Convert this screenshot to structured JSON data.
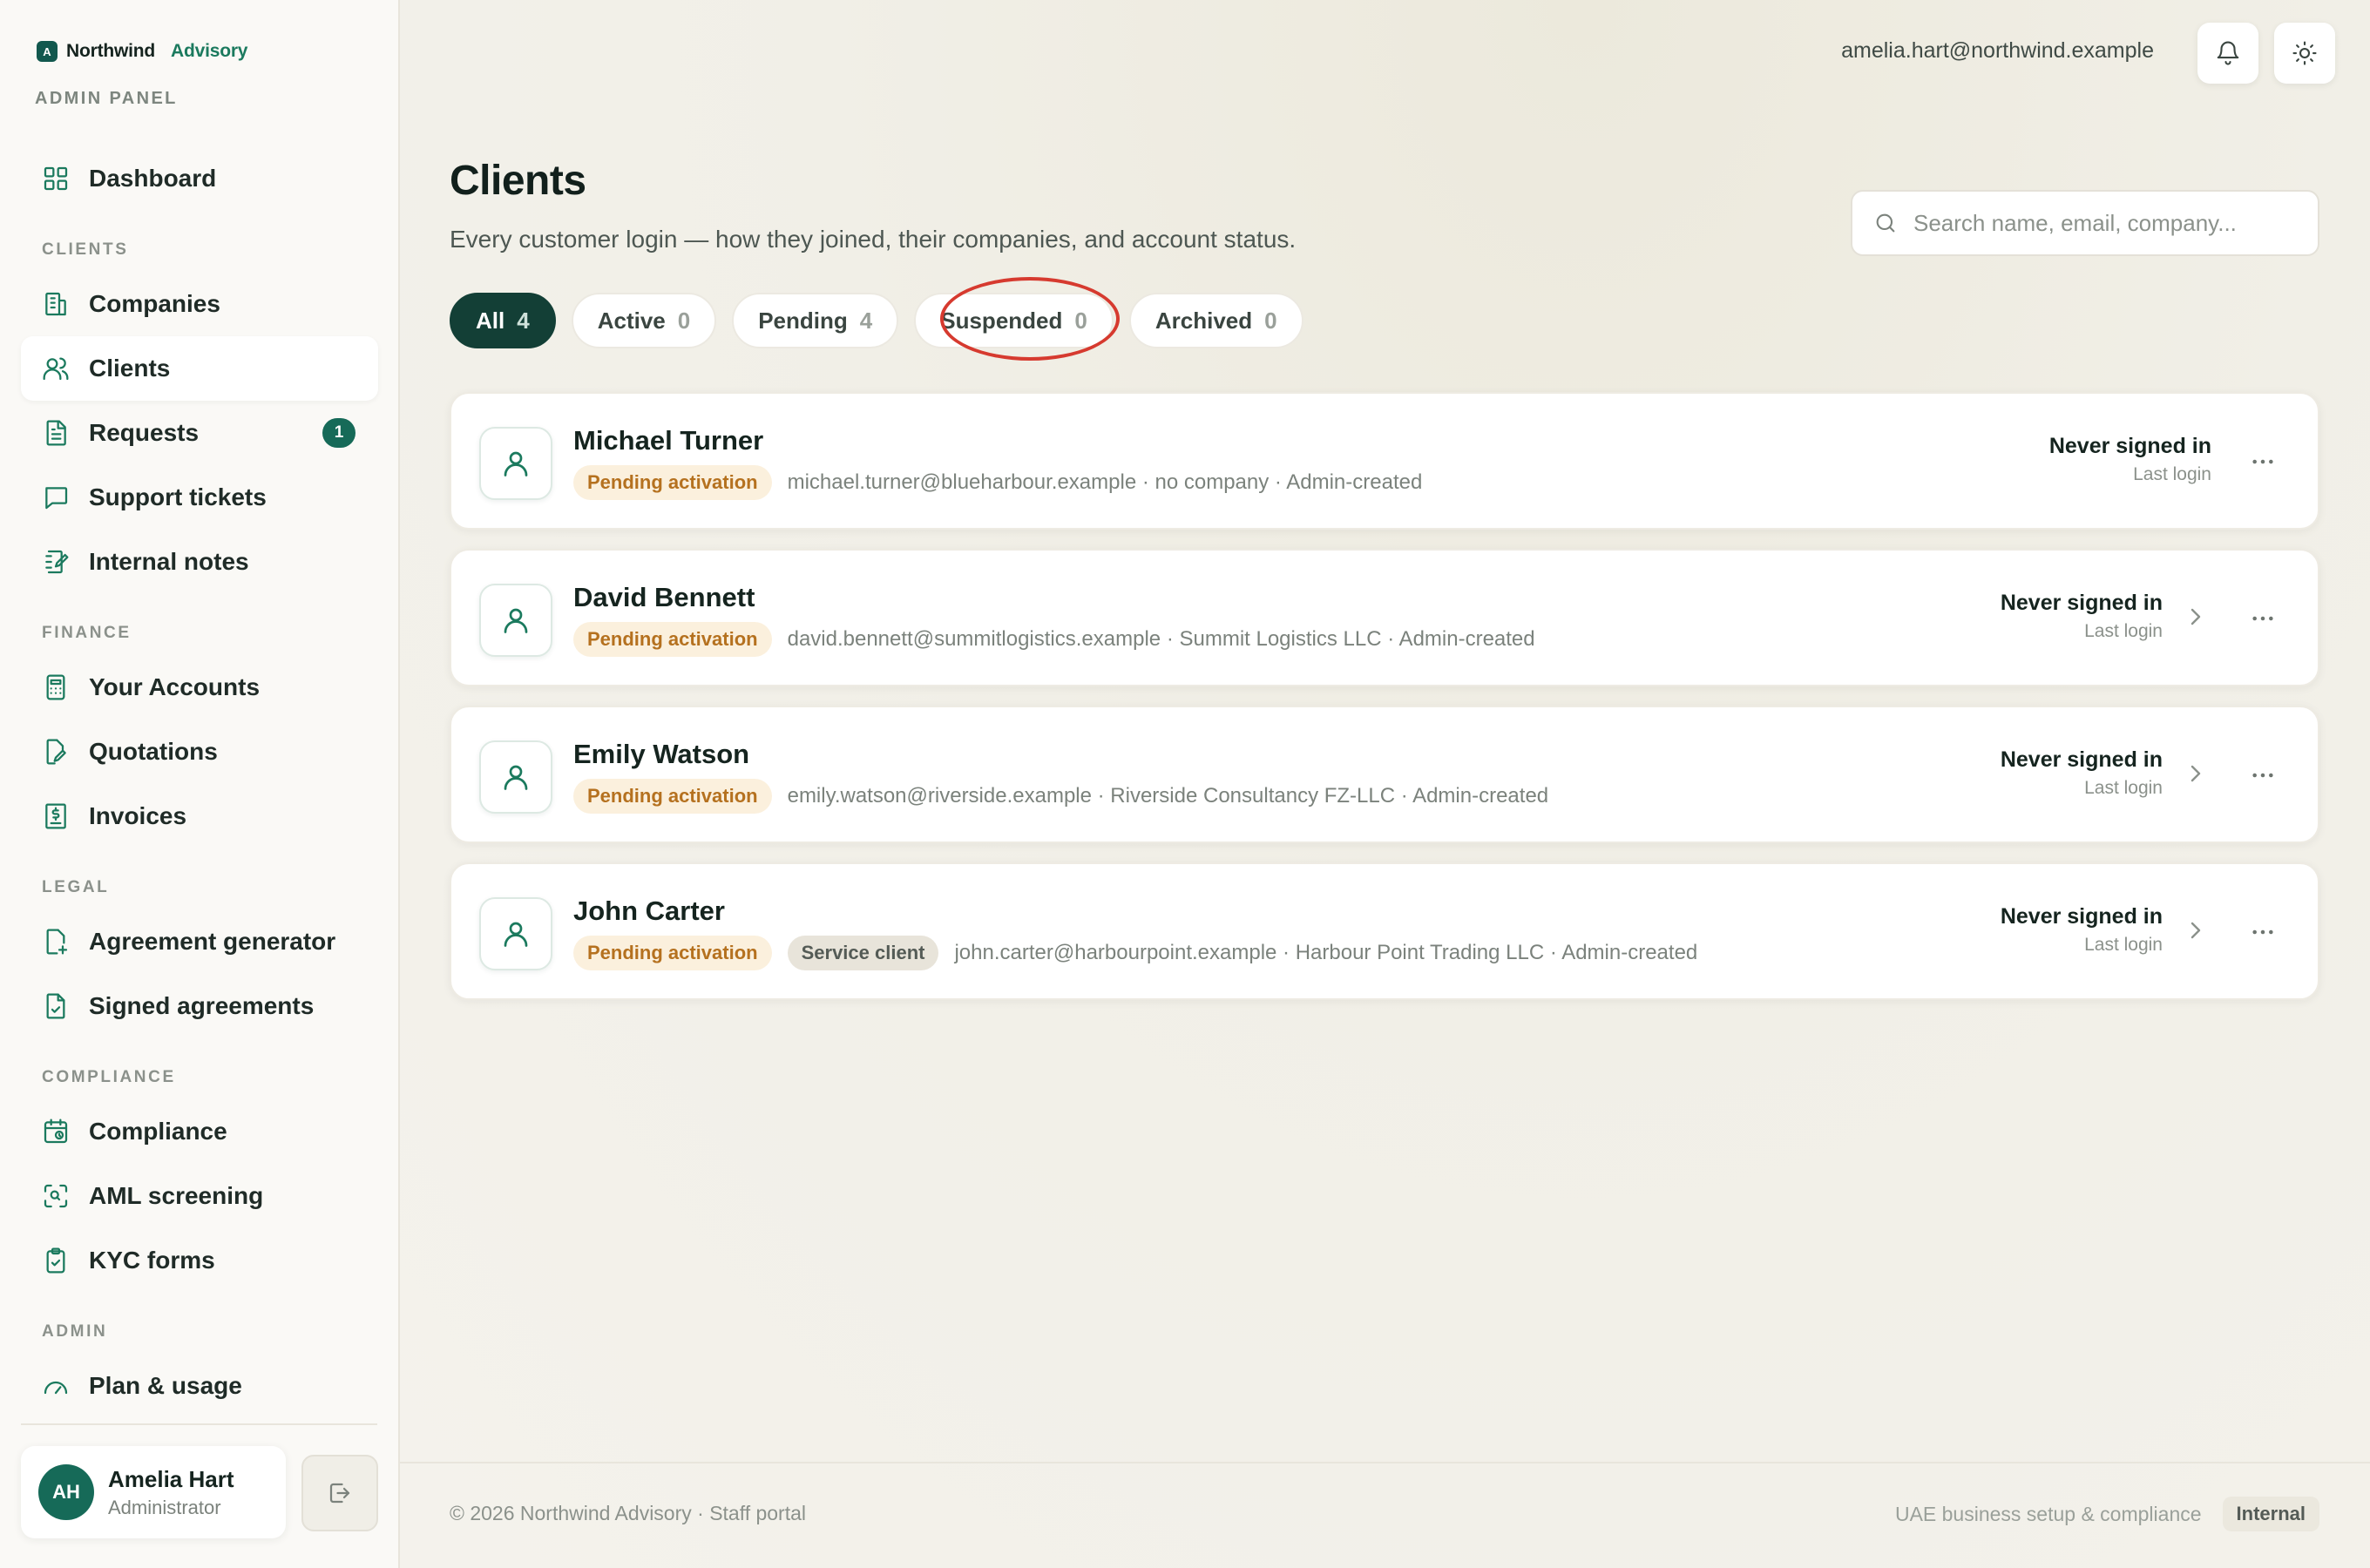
{
  "brand": {
    "mark": "A",
    "name": "Northwind",
    "sub": "Advisory",
    "panel_label": "ADMIN PANEL"
  },
  "sidebar": {
    "sections": [
      {
        "title": "",
        "items": [
          {
            "label": "Dashboard",
            "icon": "dashboard-icon",
            "active": false
          }
        ]
      },
      {
        "title": "CLIENTS",
        "items": [
          {
            "label": "Companies",
            "icon": "building-icon",
            "active": false
          },
          {
            "label": "Clients",
            "icon": "users-icon",
            "active": true
          },
          {
            "label": "Requests",
            "icon": "document-icon",
            "active": false,
            "badge": "1"
          },
          {
            "label": "Support tickets",
            "icon": "chat-icon",
            "active": false
          },
          {
            "label": "Internal notes",
            "icon": "notebook-icon",
            "active": false
          }
        ]
      },
      {
        "title": "FINANCE",
        "items": [
          {
            "label": "Your Accounts",
            "icon": "calculator-icon",
            "active": false
          },
          {
            "label": "Quotations",
            "icon": "file-edit-icon",
            "active": false
          },
          {
            "label": "Invoices",
            "icon": "invoice-icon",
            "active": false
          }
        ]
      },
      {
        "title": "LEGAL",
        "items": [
          {
            "label": "Agreement generator",
            "icon": "file-plus-icon",
            "active": false
          },
          {
            "label": "Signed agreements",
            "icon": "file-check-icon",
            "active": false
          }
        ]
      },
      {
        "title": "COMPLIANCE",
        "items": [
          {
            "label": "Compliance",
            "icon": "calendar-clock-icon",
            "active": false
          },
          {
            "label": "AML screening",
            "icon": "scan-icon",
            "active": false
          },
          {
            "label": "KYC forms",
            "icon": "clipboard-icon",
            "active": false
          }
        ]
      },
      {
        "title": "ADMIN",
        "items": [
          {
            "label": "Plan & usage",
            "icon": "gauge-icon",
            "active": false
          }
        ]
      }
    ]
  },
  "user": {
    "initials": "AH",
    "name": "Amelia Hart",
    "role": "Administrator"
  },
  "topbar": {
    "email": "amelia.hart@northwind.example"
  },
  "page": {
    "title": "Clients",
    "subtitle": "Every customer login — how they joined, their companies, and account status."
  },
  "search": {
    "placeholder": "Search name, email, company...",
    "value": ""
  },
  "filters": [
    {
      "label": "All",
      "count": "4",
      "active": true
    },
    {
      "label": "Active",
      "count": "0",
      "active": false
    },
    {
      "label": "Pending",
      "count": "4",
      "active": false
    },
    {
      "label": "Suspended",
      "count": "0",
      "active": false
    },
    {
      "label": "Archived",
      "count": "0",
      "active": false
    }
  ],
  "clients": [
    {
      "name": "Michael Turner",
      "status": "Pending activation",
      "tag": "",
      "details": "michael.turner@blueharbour.example · no company · Admin-created",
      "login_status": "Never signed in",
      "login_label": "Last login",
      "has_chevron": false
    },
    {
      "name": "David Bennett",
      "status": "Pending activation",
      "tag": "",
      "details": "david.bennett@summitlogistics.example · Summit Logistics LLC · Admin-created",
      "login_status": "Never signed in",
      "login_label": "Last login",
      "has_chevron": true
    },
    {
      "name": "Emily Watson",
      "status": "Pending activation",
      "tag": "",
      "details": "emily.watson@riverside.example · Riverside Consultancy FZ-LLC · Admin-created",
      "login_status": "Never signed in",
      "login_label": "Last login",
      "has_chevron": true
    },
    {
      "name": "John Carter",
      "status": "Pending activation",
      "tag": "Service client",
      "details": "john.carter@harbourpoint.example · Harbour Point Trading LLC · Admin-created",
      "login_status": "Never signed in",
      "login_label": "Last login",
      "has_chevron": true
    }
  ],
  "footer": {
    "copyright": "© 2026 Northwind Advisory · Staff portal",
    "tagline": "UAE business setup & compliance",
    "badge": "Internal"
  },
  "colors": {
    "accent": "#1b7a5e",
    "accent_dark": "#133f36",
    "pending": "#b5711f",
    "annotation": "#d63a2f"
  }
}
